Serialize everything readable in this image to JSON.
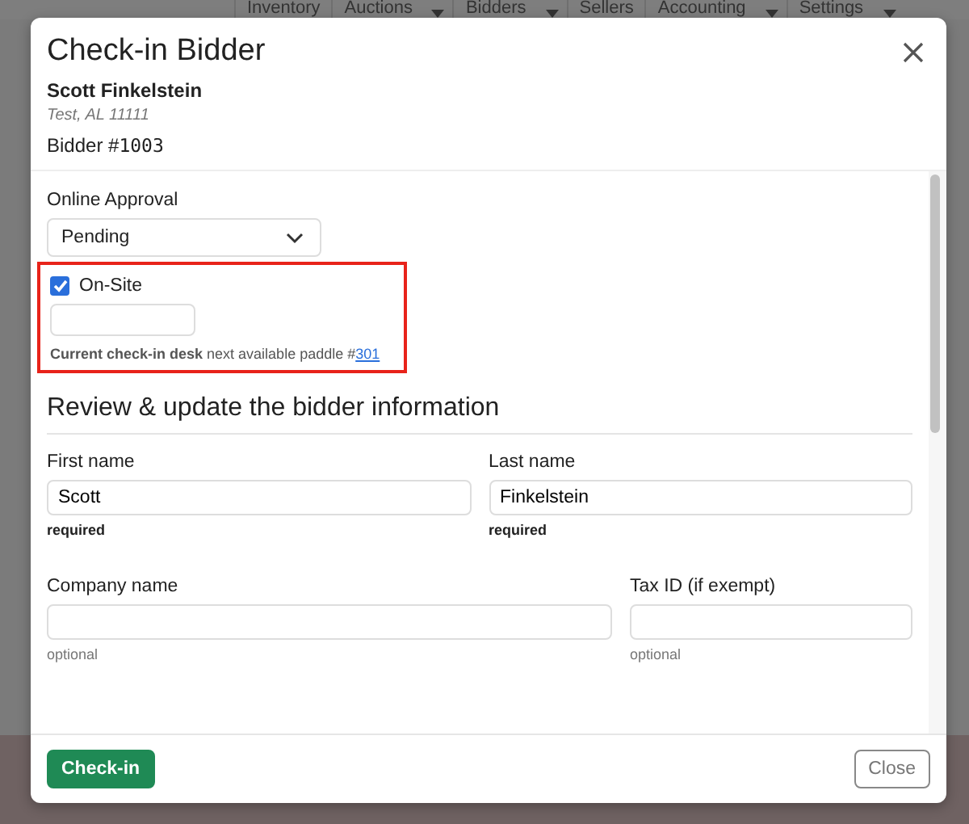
{
  "nav": [
    {
      "label": "Inventory",
      "caret": false
    },
    {
      "label": "Auctions",
      "caret": true
    },
    {
      "label": "Bidders",
      "caret": true
    },
    {
      "label": "Sellers",
      "caret": false
    },
    {
      "label": "Accounting",
      "caret": true
    },
    {
      "label": "Settings",
      "caret": true
    }
  ],
  "modal": {
    "title": "Check-in Bidder",
    "bidder_name": "Scott Finkelstein",
    "location": "Test, AL 11111",
    "bidder_label": "Bidder #",
    "bidder_number": "1003",
    "approval": {
      "label": "Online Approval",
      "value": "Pending"
    },
    "onsite": {
      "label": "On-Site",
      "checked": true,
      "highlighted": true,
      "help": "**Current check-in desk** next available paddle #",
      "paddle_link": "301"
    },
    "section_title": "Review & update the bidder information",
    "fields": [
      {
        "label": "First name",
        "value": "Scott",
        "note": "required",
        "required": true,
        "wide": false
      },
      {
        "label": "Last name",
        "value": "Finkelstein",
        "note": "required",
        "required": true,
        "wide": false
      },
      {
        "label": "Company name",
        "note": "optional",
        "required": false,
        "wide": true
      },
      {
        "label": "Tax ID (if exempt)",
        "note": "optional",
        "required": false,
        "wide": false
      }
    ],
    "buttons": [
      {
        "kind": "primary",
        "label": "Check-in"
      },
      {
        "kind": "secondary",
        "label": "Close"
      }
    ]
  }
}
